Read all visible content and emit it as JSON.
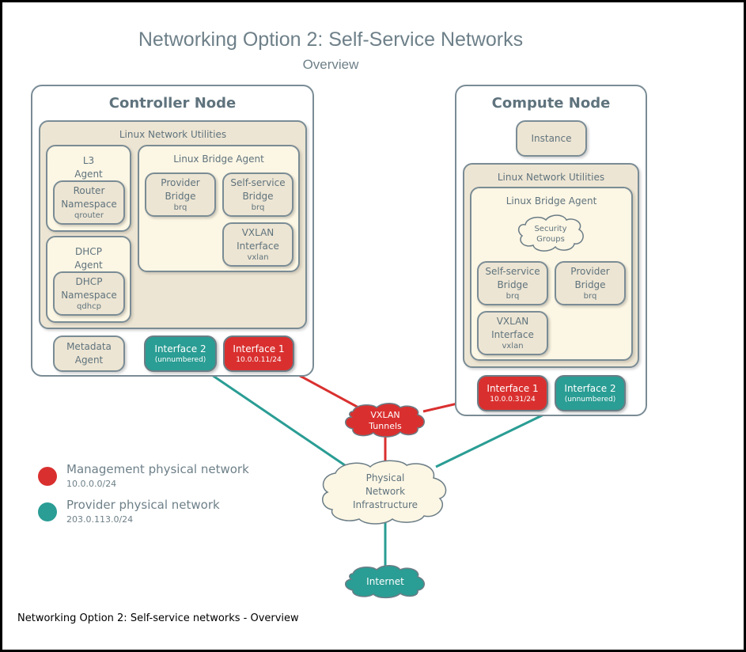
{
  "header": {
    "title": "Networking Option 2: Self-Service Networks",
    "subtitle": "Overview"
  },
  "colors": {
    "management": "#d9302f",
    "provider": "#2a9d94",
    "util_bg": "#ede5d3",
    "agent_bg": "#fcf6e4",
    "border": "#7a8c95"
  },
  "controller": {
    "title": "Controller Node",
    "utilities_title": "Linux Network Utilities",
    "l3_agent": {
      "title": "L3\nAgent",
      "title_line1": "L3",
      "title_line2": "Agent",
      "namespace": {
        "line1": "Router",
        "line2": "Namespace",
        "sub": "qrouter"
      }
    },
    "dhcp_agent": {
      "title_line1": "DHCP",
      "title_line2": "Agent",
      "namespace": {
        "line1": "DHCP",
        "line2": "Namespace",
        "sub": "qdhcp"
      }
    },
    "bridge_agent": {
      "title": "Linux Bridge Agent",
      "provider_bridge": {
        "line1": "Provider",
        "line2": "Bridge",
        "sub": "brq"
      },
      "selfservice_bridge": {
        "line1": "Self-service",
        "line2": "Bridge",
        "sub": "brq"
      },
      "vxlan_interface": {
        "line1": "VXLAN",
        "line2": "Interface",
        "sub": "vxlan"
      }
    },
    "metadata_agent": {
      "line1": "Metadata",
      "line2": "Agent"
    },
    "interface2": {
      "label": "Interface 2",
      "sub": "(unnumbered)"
    },
    "interface1": {
      "label": "Interface 1",
      "sub": "10.0.0.11/24"
    }
  },
  "compute": {
    "title": "Compute Node",
    "instance": "Instance",
    "utilities_title": "Linux Network Utilities",
    "bridge_agent": {
      "title": "Linux Bridge Agent",
      "security_groups": {
        "line1": "Security",
        "line2": "Groups"
      },
      "selfservice_bridge": {
        "line1": "Self-service",
        "line2": "Bridge",
        "sub": "brq"
      },
      "provider_bridge": {
        "line1": "Provider",
        "line2": "Bridge",
        "sub": "brq"
      },
      "vxlan_interface": {
        "line1": "VXLAN",
        "line2": "Interface",
        "sub": "vxlan"
      }
    },
    "interface1": {
      "label": "Interface 1",
      "sub": "10.0.0.31/24"
    },
    "interface2": {
      "label": "Interface 2",
      "sub": "(unnumbered)"
    }
  },
  "clouds": {
    "vxlan_tunnels": {
      "line1": "VXLAN",
      "line2": "Tunnels"
    },
    "physical": {
      "line1": "Physical",
      "line2": "Network",
      "line3": "Infrastructure"
    },
    "internet": {
      "line1": "Internet"
    }
  },
  "legend": [
    {
      "label": "Management physical network",
      "sub": "10.0.0.0/24",
      "color": "#d9302f"
    },
    {
      "label": "Provider physical network",
      "sub": "203.0.113.0/24",
      "color": "#2a9d94"
    }
  ],
  "caption": "Networking Option 2: Self-service networks - Overview"
}
